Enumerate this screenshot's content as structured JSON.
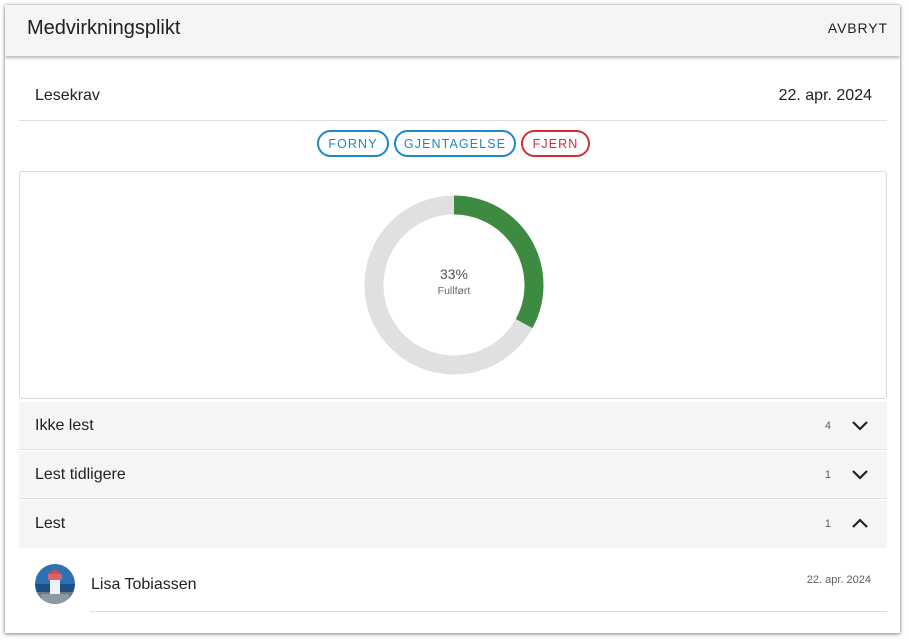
{
  "dialog": {
    "title": "Medvirkningsplikt",
    "cancel_label": "AVBRYT"
  },
  "requirement": {
    "label": "Lesekrav",
    "date": "22. apr. 2024"
  },
  "actions": {
    "renew_label": "FORNY",
    "repeat_label": "GJENTAGELSE",
    "remove_label": "FJERN"
  },
  "progress": {
    "percent_text": "33%",
    "label": "Fullført",
    "fraction": 0.33,
    "colors": {
      "complete": "#3d8b40",
      "remaining": "#e0e0e0"
    }
  },
  "groups": [
    {
      "label": "Ikke lest",
      "count": "4",
      "expanded": false
    },
    {
      "label": "Lest tidligere",
      "count": "1",
      "expanded": false
    },
    {
      "label": "Lest",
      "count": "1",
      "expanded": true
    }
  ],
  "readers": [
    {
      "name": "Lisa Tobiassen",
      "date": "22. apr. 2024",
      "avatar_icon": "lighthouse-photo"
    }
  ],
  "colors": {
    "accent_blue": "#1e88c7",
    "danger_red": "#d32f2f",
    "header_bg": "#f5f5f5"
  }
}
